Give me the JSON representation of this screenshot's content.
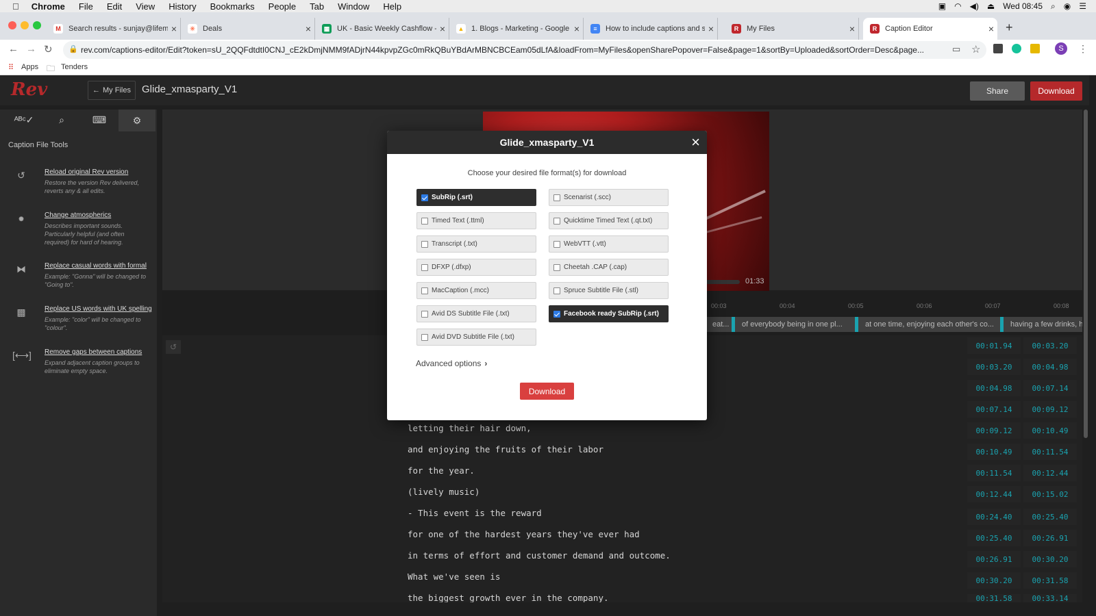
{
  "menubar": {
    "app": "Chrome",
    "items": [
      "File",
      "Edit",
      "View",
      "History",
      "Bookmarks",
      "People",
      "Tab",
      "Window",
      "Help"
    ],
    "clock": "Wed 08:45"
  },
  "tabs": [
    {
      "label": "Search results - sunjay@lifeme",
      "icon": "gmail-icon",
      "color": "#d93025",
      "glyph": "M"
    },
    {
      "label": "Deals",
      "icon": "hubspot-icon",
      "color": "#ff7a59",
      "glyph": "✳"
    },
    {
      "label": "UK - Basic Weekly Cashflow -",
      "icon": "sheets-icon",
      "color": "#0f9d58",
      "glyph": "▦"
    },
    {
      "label": "1. Blogs - Marketing - Google D",
      "icon": "drive-icon",
      "color": "#f4b400",
      "glyph": "▲"
    },
    {
      "label": "How to include captions and su",
      "icon": "docs-icon",
      "color": "#4285f4",
      "glyph": "≡"
    },
    {
      "label": "My Files",
      "icon": "rev-icon",
      "color": "#c0272d",
      "glyph": "R"
    },
    {
      "label": "Caption Editor",
      "icon": "rev-icon",
      "color": "#c0272d",
      "glyph": "R"
    }
  ],
  "address": {
    "url": "rev.com/captions-editor/Edit?token=sU_2QQFdtdtI0CNJ_cE2kDmjNMM9fADjrN44kpvpZGc0mRkQBuYBdArMBNCBCEam05dLfA&loadFrom=MyFiles&openSharePopover=False&page=1&sortBy=Uploaded&sortOrder=Desc&page..."
  },
  "bookmarks": {
    "apps": "Apps",
    "folder": "Tenders"
  },
  "app": {
    "logo": "Rev",
    "back_label": "My Files",
    "file_title": "Glide_xmasparty_V1",
    "share_label": "Share",
    "download_label": "Download",
    "brand_color": "#b5292b"
  },
  "sidebar": {
    "heading": "Caption File Tools",
    "tools": [
      {
        "title": "Reload original Rev version",
        "desc": "Restore the version Rev delivered, reverts any & all edits."
      },
      {
        "title": "Change atmospherics",
        "desc": "Describes important sounds. Particularly helpful (and often required) for hard of hearing."
      },
      {
        "title": "Replace casual words with formal",
        "desc": "Example: \"Gonna\" will be changed to \"Going to\"."
      },
      {
        "title": "Replace US words with UK spelling",
        "desc": "Example: \"color\" will be changed to \"colour\"."
      },
      {
        "title": "Remove gaps between captions",
        "desc": "Expand adjacent caption groups to eliminate empty space."
      }
    ]
  },
  "player": {
    "duration": "01:33"
  },
  "timeline": {
    "ticks": [
      "00:03",
      "00:04",
      "00:05",
      "00:06",
      "00:07",
      "00:08"
    ],
    "segments": [
      "eat...",
      "of everybody being in one pl...",
      "at one time, enjoying each other's co...",
      "having a few drinks, ha"
    ]
  },
  "captions": [
    {
      "text": "",
      "start": "00:01.94",
      "end": "00:03.20"
    },
    {
      "text": "",
      "start": "00:03.20",
      "end": "00:04.98"
    },
    {
      "text": "",
      "start": "00:04.98",
      "end": "00:07.14"
    },
    {
      "text": "",
      "start": "00:07.14",
      "end": "00:09.12"
    },
    {
      "text": "letting their hair down,",
      "start": "00:09.12",
      "end": "00:10.49"
    },
    {
      "text": "and enjoying the fruits of their labor",
      "start": "00:10.49",
      "end": "00:11.54"
    },
    {
      "text": "for the year.",
      "start": "00:11.54",
      "end": "00:12.44"
    },
    {
      "text": "(lively music)",
      "start": "00:12.44",
      "end": "00:15.02"
    },
    {
      "text": "- This event is the reward",
      "start": "00:24.40",
      "end": "00:25.40"
    },
    {
      "text": "for one of the hardest years they've ever had",
      "start": "00:25.40",
      "end": "00:26.91"
    },
    {
      "text": "in terms of effort and customer demand and outcome.",
      "start": "00:26.91",
      "end": "00:30.20"
    },
    {
      "text": "What we've seen is",
      "start": "00:30.20",
      "end": "00:31.58"
    },
    {
      "text": "the biggest growth ever in the company.",
      "start": "00:31.58",
      "end": "00:33.14"
    }
  ],
  "modal": {
    "title": "Glide_xmasparty_V1",
    "prompt": "Choose your desired file format(s) for download",
    "formats_left": [
      {
        "label": "SubRip (.srt)",
        "checked": true
      },
      {
        "label": "Timed Text (.ttml)",
        "checked": false
      },
      {
        "label": "Transcript (.txt)",
        "checked": false
      },
      {
        "label": "DFXP (.dfxp)",
        "checked": false
      },
      {
        "label": "MacCaption (.mcc)",
        "checked": false
      },
      {
        "label": "Avid DS Subtitle File (.txt)",
        "checked": false
      },
      {
        "label": "Avid DVD Subtitle File (.txt)",
        "checked": false
      }
    ],
    "formats_right": [
      {
        "label": "Scenarist (.scc)",
        "checked": false
      },
      {
        "label": "Quicktime Timed Text (.qt.txt)",
        "checked": false
      },
      {
        "label": "WebVTT (.vtt)",
        "checked": false
      },
      {
        "label": "Cheetah .CAP (.cap)",
        "checked": false
      },
      {
        "label": "Spruce Subtitle File (.stl)",
        "checked": false
      },
      {
        "label": "Facebook ready SubRip (.srt)",
        "checked": true
      }
    ],
    "advanced_label": "Advanced options",
    "download_label": "Download",
    "download_color": "#d9403f"
  }
}
